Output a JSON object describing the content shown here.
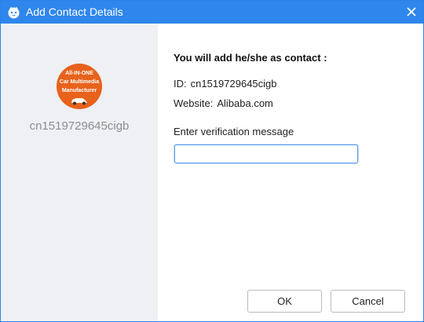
{
  "window": {
    "title": "Add Contact Details",
    "accent_color": "#2f86ec",
    "close_icon": "close-icon",
    "logo_icon": "app-logo-icon"
  },
  "contact": {
    "avatar_lines": [
      "All-IN-ONE",
      "Car Multimedia",
      "Manufacturer"
    ],
    "avatar_color": "#e8621c",
    "username": "cn1519729645cigb"
  },
  "details": {
    "heading": "You will add he/she as contact :",
    "id_label": "ID:",
    "id_value": "cn1519729645cigb",
    "website_label": "Website:",
    "website_value": "Alibaba.com",
    "verify_label": "Enter verification message",
    "verify_value": "",
    "verify_placeholder": ""
  },
  "buttons": {
    "ok": "OK",
    "cancel": "Cancel"
  }
}
